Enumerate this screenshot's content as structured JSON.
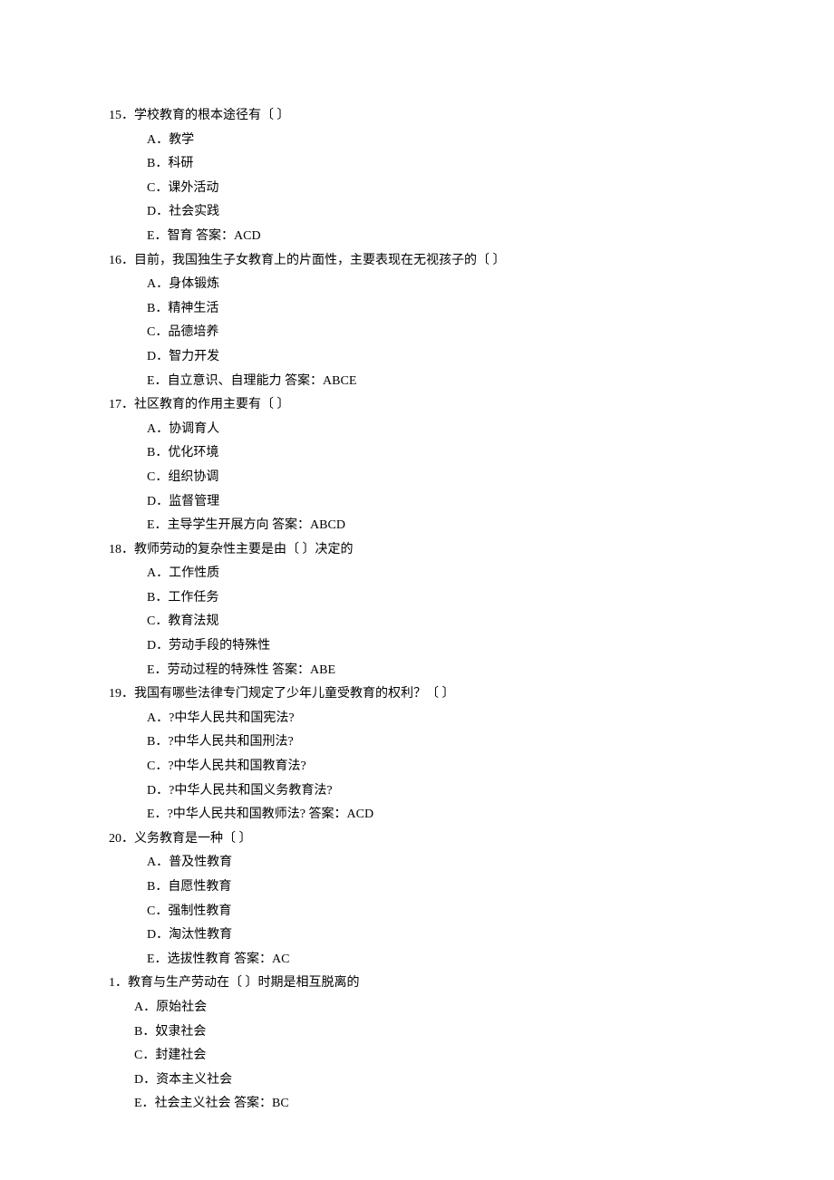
{
  "questions": [
    {
      "num": "15．",
      "stem": "学校教育的根本途径有〔 〕",
      "options": [
        {
          "label": "A．",
          "text": "教学"
        },
        {
          "label": "B．",
          "text": "科研"
        },
        {
          "label": "C．",
          "text": "课外活动"
        },
        {
          "label": "D．",
          "text": "社会实践"
        },
        {
          "label": "E．",
          "text": "智育",
          "answer": " 答案：ACD"
        }
      ]
    },
    {
      "num": "16．",
      "stem": "目前，我国独生子女教育上的片面性，主要表现在无视孩子的〔 〕",
      "options": [
        {
          "label": "A．",
          "text": "身体锻炼"
        },
        {
          "label": "B．",
          "text": "精神生活"
        },
        {
          "label": "C．",
          "text": "品德培养"
        },
        {
          "label": "D．",
          "text": "智力开发"
        },
        {
          "label": "E．",
          "text": "自立意识、自理能力",
          "answer": " 答案：ABCE"
        }
      ]
    },
    {
      "num": "17．",
      "stem": "社区教育的作用主要有〔 〕",
      "options": [
        {
          "label": "A．",
          "text": "协调育人"
        },
        {
          "label": "B．",
          "text": "优化环境"
        },
        {
          "label": "C．",
          "text": "组织协调"
        },
        {
          "label": "D．",
          "text": "监督管理"
        },
        {
          "label": "E．",
          "text": "主导学生开展方向",
          "answer": " 答案：ABCD"
        }
      ]
    },
    {
      "num": "18．",
      "stem": "教师劳动的复杂性主要是由〔 〕决定的",
      "options": [
        {
          "label": "A．",
          "text": "工作性质"
        },
        {
          "label": "B．",
          "text": "工作任务"
        },
        {
          "label": "C．",
          "text": "教育法规"
        },
        {
          "label": "D．",
          "text": "劳动手段的特殊性"
        },
        {
          "label": "E．",
          "text": "劳动过程的特殊性",
          "answer": " 答案：ABE"
        }
      ]
    },
    {
      "num": "19．",
      "stem": "我国有哪些法律专门规定了少年儿童受教育的权利？〔 〕",
      "options": [
        {
          "label": "A．",
          "text": "?中华人民共和国宪法?"
        },
        {
          "label": "B．",
          "text": "?中华人民共和国刑法?"
        },
        {
          "label": "C．",
          "text": "?中华人民共和国教育法?"
        },
        {
          "label": "D．",
          "text": "?中华人民共和国义务教育法?"
        },
        {
          "label": "E．",
          "text": "?中华人民共和国教师法?",
          "answer": " 答案：ACD"
        }
      ]
    },
    {
      "num": "20．",
      "stem": "义务教育是一种〔 〕",
      "options": [
        {
          "label": "A．",
          "text": "普及性教育"
        },
        {
          "label": "B．",
          "text": "自愿性教育"
        },
        {
          "label": "C．",
          "text": "强制性教育"
        },
        {
          "label": "D．",
          "text": "淘汰性教育"
        },
        {
          "label": "E．",
          "text": "选拔性教育",
          "answer": " 答案：AC"
        }
      ]
    },
    {
      "num": "1．",
      "stem": "教育与生产劳动在〔 〕时期是相互脱离的",
      "options": [
        {
          "label": "A．",
          "text": "原始社会"
        },
        {
          "label": "B．",
          "text": "奴隶社会"
        },
        {
          "label": "C．",
          "text": "封建社会"
        },
        {
          "label": "D．",
          "text": "资本主义社会"
        },
        {
          "label": "E．",
          "text": "社会主义社会",
          "answer": " 答案：BC"
        }
      ]
    }
  ]
}
